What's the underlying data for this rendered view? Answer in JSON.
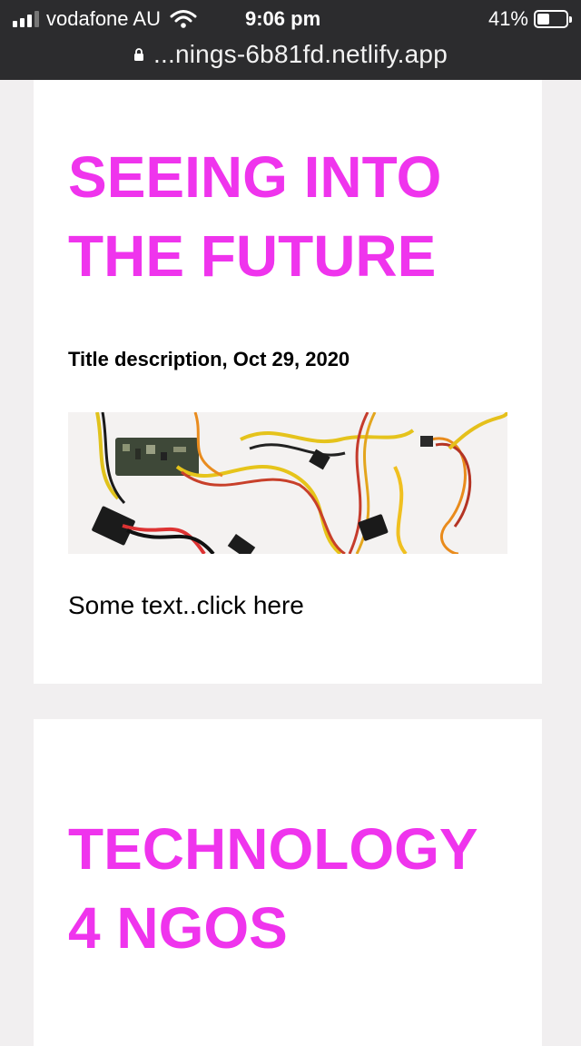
{
  "status_bar": {
    "carrier": "vodafone AU",
    "time": "9:06 pm",
    "battery_percent": "41%",
    "url": "...nings-6b81fd.netlify.app"
  },
  "posts": [
    {
      "title_line1": "SEEING INTO",
      "title_line2": "THE FUTURE",
      "description": "Title description, Oct 29, 2020",
      "text": "Some text..click here"
    },
    {
      "title_line1": "TECHNOLOGY",
      "title_line2": "4 NGOS"
    }
  ],
  "colors": {
    "accent": "#ef34ed",
    "browser_chrome": "#2c2c2e",
    "page_background": "#f1eff0",
    "card_background": "#ffffff"
  },
  "icons": [
    "signal-icon",
    "wifi-icon",
    "battery-icon",
    "lock-icon"
  ]
}
